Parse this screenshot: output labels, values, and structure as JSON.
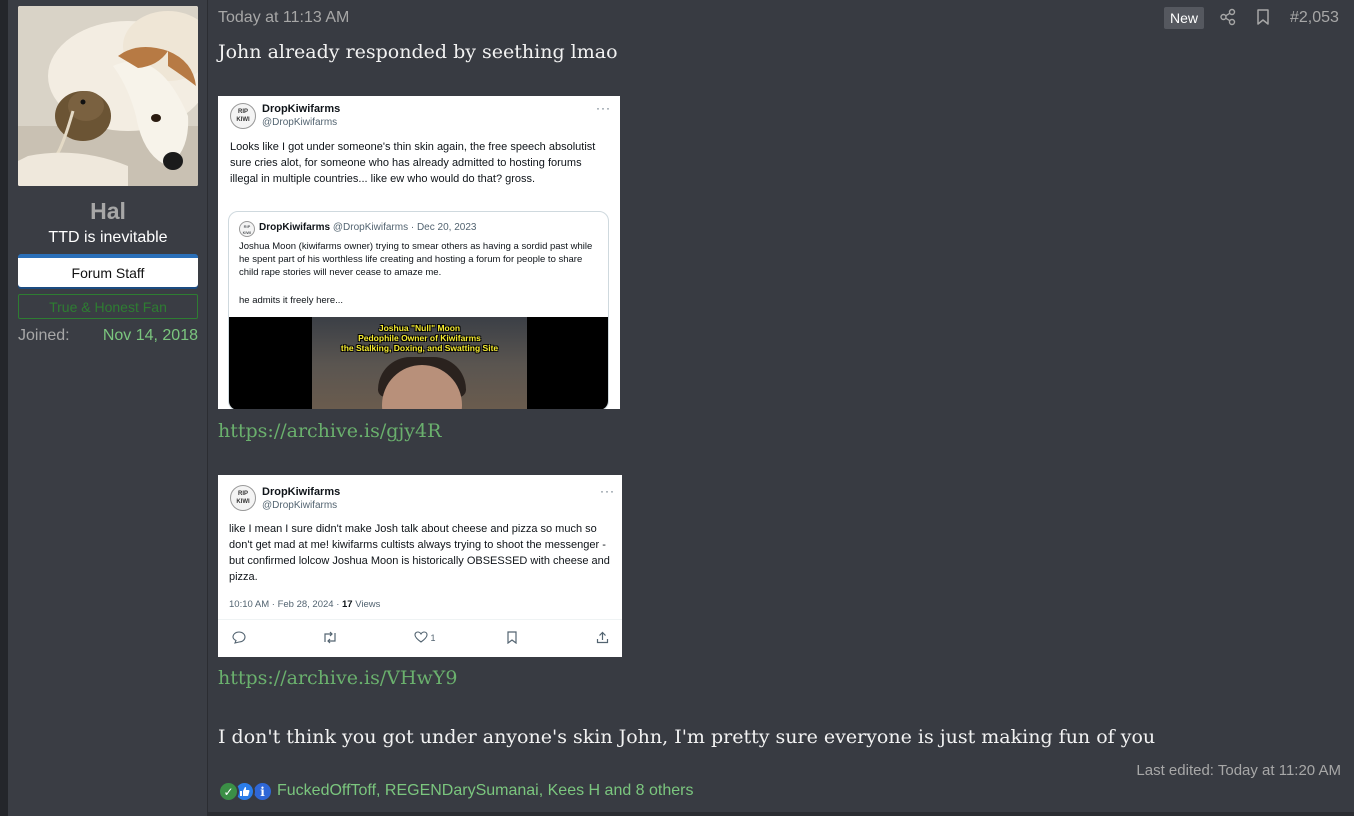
{
  "user": {
    "name": "Hal",
    "title": "TTD is inevitable",
    "banner_staff": "Forum Staff",
    "banner_fan": "True & Honest Fan",
    "joined_label": "Joined:",
    "joined_value": "Nov 14, 2018",
    "avatar_icon": "dog-and-kiwi-avatar"
  },
  "post": {
    "time": "Today at 11:13 AM",
    "new_badge": "New",
    "number": "#2,053",
    "share_icon": "share-icon",
    "bookmark_icon": "bookmark-icon",
    "line1": "John already responded by seething lmao",
    "link1": "https://archive.is/gjy4R",
    "link2": "https://archive.is/VHwY9",
    "line3": "I don't think you got under anyone's skin John, I'm pretty sure everyone is just making fun of you",
    "last_edited": "Last edited: Today at 11:20 AM"
  },
  "tweet1": {
    "avatar_text": "RIP KIWI",
    "name": "DropKiwifarms",
    "handle": "@DropKiwifarms",
    "more": "···",
    "text": "Looks like I got under someone's thin skin again, the free speech absolutist sure cries alot, for someone who has already admitted to hosting forums illegal in multiple countries... like ew who would do that? gross.",
    "quote": {
      "name": "DropKiwifarms",
      "meta": "@DropKiwifarms · Dec 20, 2023",
      "text": "Joshua Moon (kiwifarms owner) trying to smear others as having a sordid past while he spent part of his worthless life creating and hosting a forum for people to share child rape stories will never cease to amaze me.",
      "text2": "he admits it freely here...",
      "video_caption_1": "Joshua \"Null\" Moon",
      "video_caption_2": "Pedophile Owner of Kiwifarms",
      "video_caption_3": "the Stalking, Doxing, and Swatting Site"
    }
  },
  "tweet2": {
    "avatar_text": "RIP KIWI",
    "name": "DropKiwifarms",
    "handle": "@DropKiwifarms",
    "more": "···",
    "text": "like I mean I sure didn't make Josh talk about cheese and pizza so much so don't get mad at me! kiwifarms cultists always trying to shoot the messenger - but confirmed lolcow Joshua Moon is historically OBSESSED with cheese and pizza.",
    "meta_time": "10:10 AM · Feb 28, 2024 · ",
    "meta_views_count": "17",
    "meta_views_label": " Views",
    "like_count": "1"
  },
  "reactions": {
    "icons": [
      "check-icon",
      "thumbs-up-icon",
      "info-icon"
    ],
    "list": "FuckedOffToff, REGENDarySumanai, Kees H and 8 others"
  }
}
